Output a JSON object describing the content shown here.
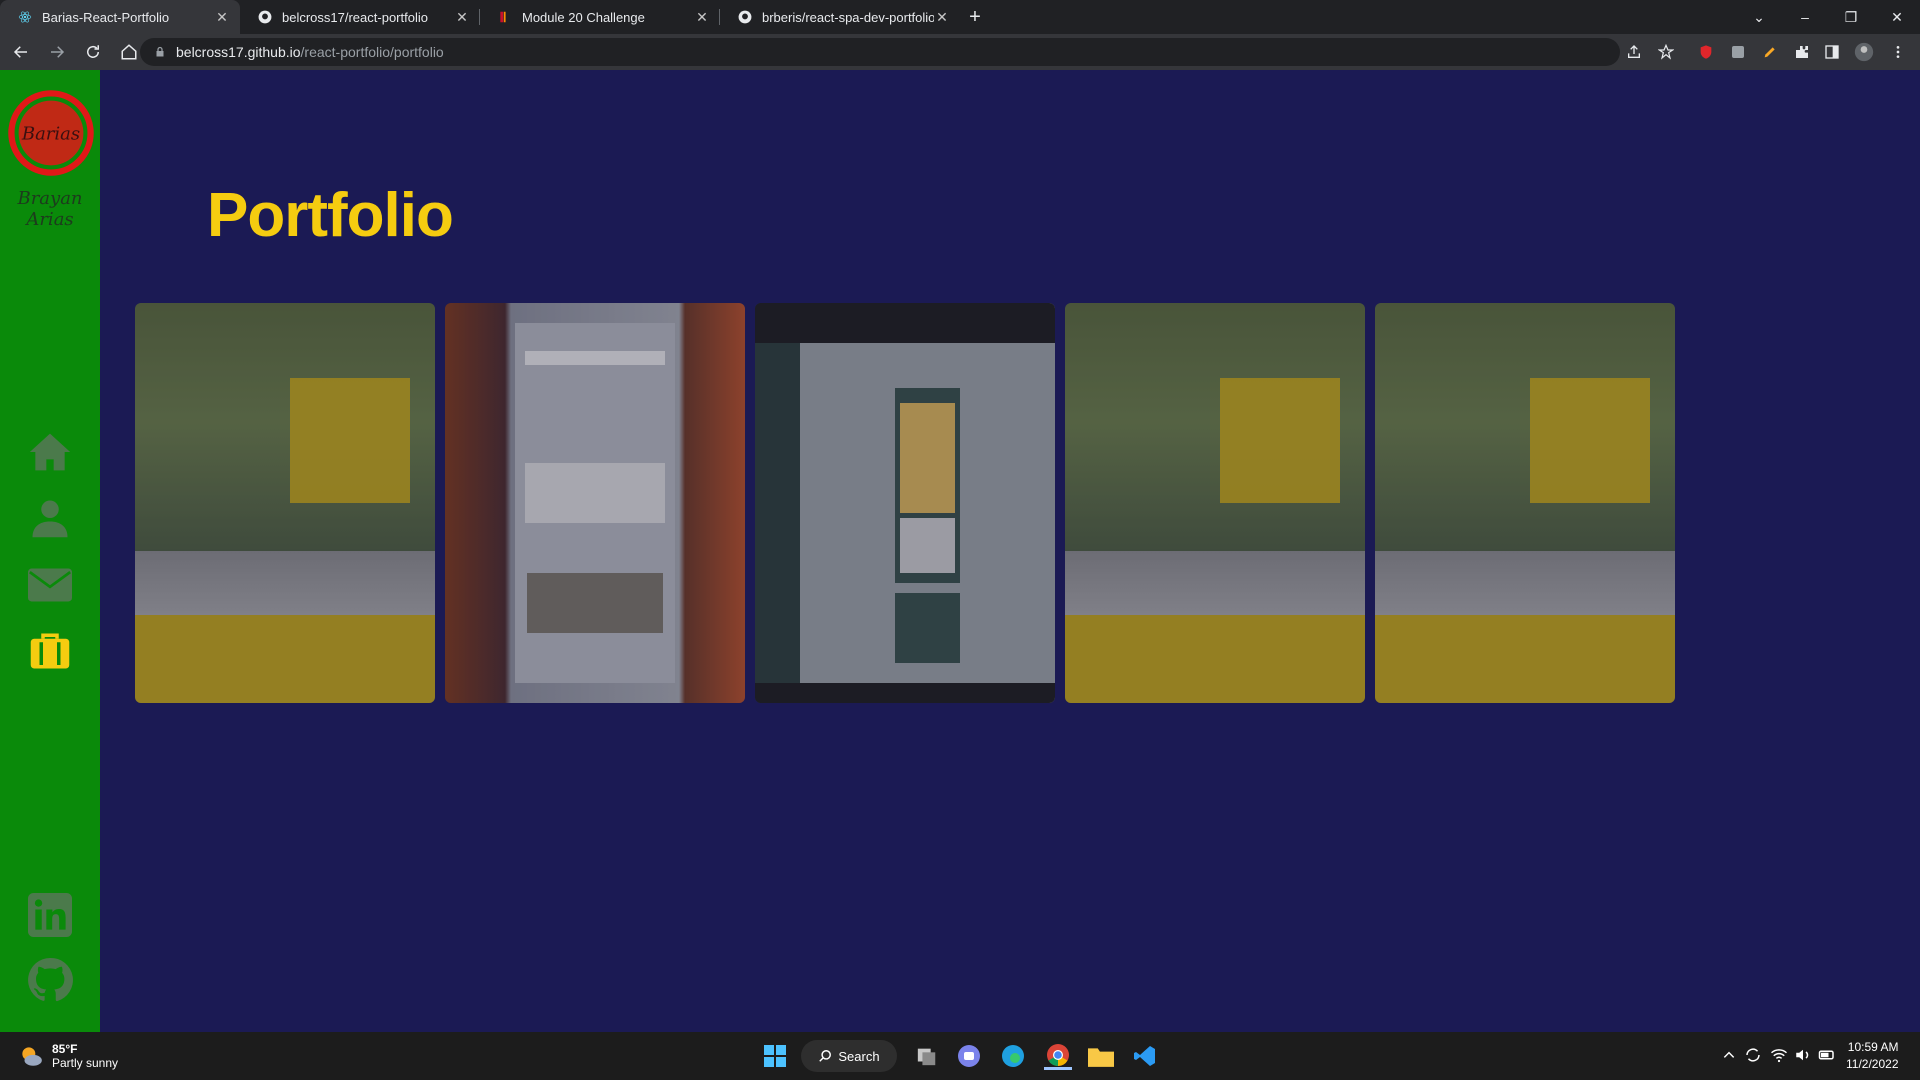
{
  "browser": {
    "tabs": [
      {
        "title": "Barias-React-Portfolio",
        "close": "✕",
        "active": true
      },
      {
        "title": "belcross17/react-portfolio",
        "close": "✕",
        "active": false
      },
      {
        "title": "Module 20 Challenge",
        "close": "✕",
        "active": false
      },
      {
        "title": "brberis/react-spa-dev-portfolio-g",
        "close": "✕",
        "active": false
      }
    ],
    "new_tab": "+",
    "window_controls": {
      "dropdown": "⌄",
      "minimize": "–",
      "restore": "❐",
      "close": "✕"
    },
    "url_host": "belcross17.github.io",
    "url_path": "/react-portfolio/portfolio"
  },
  "sidebar": {
    "logo_text": "Barias",
    "logo_subtitle": "Brayan Arias",
    "colors": {
      "background": "#0a8a0a",
      "logo": "#e01818",
      "active": "#f5cc10",
      "icon": "#4b7a4b"
    }
  },
  "main": {
    "heading": "Portfolio",
    "projects": [
      {
        "variant": "zoom"
      },
      {
        "variant": "weather"
      },
      {
        "variant": "recipe"
      },
      {
        "variant": "zoom"
      },
      {
        "variant": "zoom"
      }
    ]
  },
  "taskbar": {
    "weather_temp": "85°F",
    "weather_desc": "Partly sunny",
    "search_label": "Search",
    "time": "10:59 AM",
    "date": "11/2/2022"
  }
}
